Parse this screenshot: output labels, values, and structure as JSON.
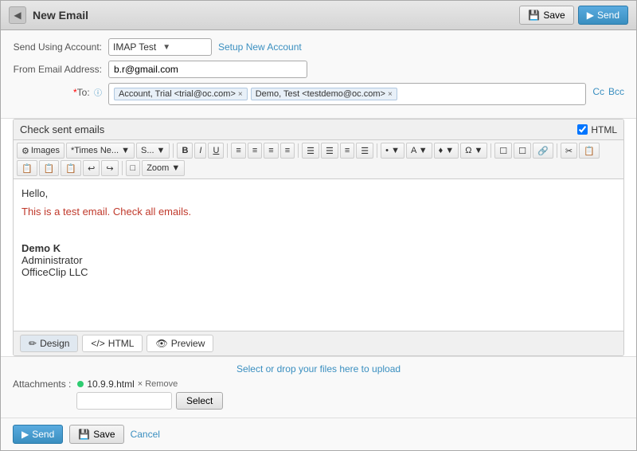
{
  "window": {
    "title": "New Email",
    "back_label": "◀"
  },
  "titlebar": {
    "save_label": "Save",
    "send_label": "Send",
    "save_icon": "💾",
    "send_icon": "▶"
  },
  "form": {
    "send_using_label": "Send Using Account:",
    "from_label": "From Email Address:",
    "to_label": "*To:",
    "account_value": "IMAP Test",
    "setup_link": "Setup New Account",
    "from_email": "b.r@gmail.com",
    "to_tokens": [
      {
        "label": "Account, Trial <trial@oc.com>"
      },
      {
        "label": "Demo, Test <testdemo@oc.com>"
      }
    ],
    "cc_label": "Cc",
    "bcc_label": "Bcc"
  },
  "editor": {
    "subject": "Check sent emails",
    "html_label": "HTML",
    "body_lines": [
      {
        "text": "Hello,",
        "style": "normal"
      },
      {
        "text": "This is a test email. Check all emails.",
        "style": "orange"
      },
      {
        "text": "",
        "style": "normal"
      },
      {
        "text": "Demo K",
        "style": "bold"
      },
      {
        "text": "Administrator",
        "style": "normal"
      },
      {
        "text": "OfficeClip LLC",
        "style": "normal"
      }
    ],
    "tabs": [
      {
        "label": "✏ Design",
        "active": true
      },
      {
        "label": "</> HTML",
        "active": false
      },
      {
        "label": "👁 Preview",
        "active": false
      }
    ]
  },
  "toolbar": {
    "buttons": [
      {
        "label": "⚙ Images"
      },
      {
        "label": "*Times Ne... ▼"
      },
      {
        "label": "S... ▼"
      },
      {
        "label": "B",
        "bold": true
      },
      {
        "label": "I",
        "italic": true
      },
      {
        "label": "U",
        "underline": true
      },
      {
        "label": "≡"
      },
      {
        "label": "≡"
      },
      {
        "label": "≡"
      },
      {
        "label": "≡"
      },
      {
        "label": "☰"
      },
      {
        "label": "☰"
      },
      {
        "label": "≡"
      },
      {
        "label": "☰"
      },
      {
        "label": "• ▼"
      },
      {
        "label": "A ▼"
      },
      {
        "label": "♦ ▼"
      },
      {
        "label": "Ω ▼"
      },
      {
        "label": "☐"
      },
      {
        "label": "☐"
      },
      {
        "label": "🔗"
      },
      {
        "label": "✂"
      },
      {
        "label": "📋"
      },
      {
        "label": "📋"
      },
      {
        "label": "📋"
      },
      {
        "label": "📋"
      },
      {
        "label": "📋"
      },
      {
        "label": "📋"
      },
      {
        "label": "□"
      },
      {
        "label": "Zoom ▼"
      }
    ]
  },
  "attachments": {
    "hint": "Select or drop your files here to upload",
    "label": "Attachments :",
    "files": [
      {
        "name": "10.9.9.html"
      }
    ],
    "remove_label": "× Remove",
    "select_button": "Select",
    "input_placeholder": ""
  },
  "footer": {
    "send_label": "Send",
    "save_label": "Save",
    "cancel_label": "Cancel",
    "send_icon": "▶",
    "save_icon": "💾"
  }
}
